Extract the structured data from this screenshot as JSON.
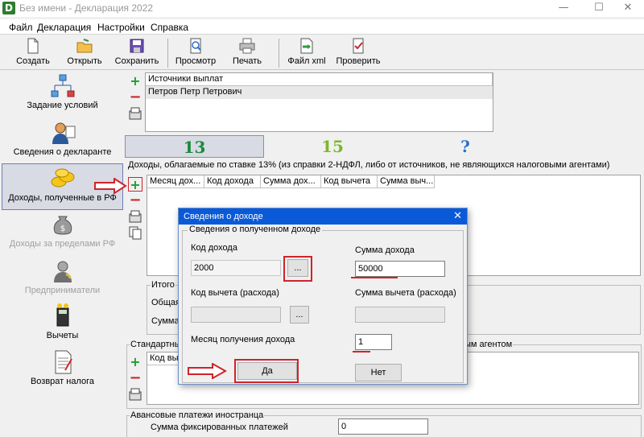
{
  "window": {
    "title": "Без имени - Декларация 2022",
    "minimize": "—",
    "maximize": "☐",
    "close": "✕"
  },
  "menu": [
    "Файл",
    "Декларация",
    "Настройки",
    "Справка"
  ],
  "toolbar": {
    "buttons": [
      {
        "label": "Создать",
        "icon": "new-file-icon"
      },
      {
        "label": "Открыть",
        "icon": "open-folder-icon"
      },
      {
        "label": "Сохранить",
        "icon": "save-icon"
      },
      {
        "label": "Просмотр",
        "icon": "preview-icon"
      },
      {
        "label": "Печать",
        "icon": "print-icon"
      },
      {
        "label": "Файл xml",
        "icon": "xml-file-icon"
      },
      {
        "label": "Проверить",
        "icon": "check-icon"
      }
    ]
  },
  "nav": {
    "items": [
      {
        "label": "Задание условий",
        "icon": "hierarchy-icon",
        "state": "normal"
      },
      {
        "label": "Сведения о декларанте",
        "icon": "person-icon",
        "state": "normal"
      },
      {
        "label": "Доходы, полученные в РФ",
        "icon": "coins-icon",
        "state": "active"
      },
      {
        "label": "Доходы за пределами РФ",
        "icon": "money-bag-icon",
        "state": "disabled"
      },
      {
        "label": "Предприниматели",
        "icon": "businessman-icon",
        "state": "disabled"
      },
      {
        "label": "Вычеты",
        "icon": "calculator-icon",
        "state": "normal"
      },
      {
        "label": "Возврат налога",
        "icon": "document-icon",
        "state": "normal"
      }
    ]
  },
  "sources": {
    "header": "Источники выплат",
    "rows": [
      "Петров Петр Петрович"
    ]
  },
  "rate_tabs": [
    "13",
    "15",
    "?"
  ],
  "income": {
    "caption": "Доходы, облагаемые по ставке 13% (из справки 2-НДФЛ, либо от источников, не являющихся налоговыми агентами)",
    "columns": [
      "Месяц дох...",
      "Код дохода",
      "Сумма дох...",
      "Код вычета",
      "Сумма выч..."
    ]
  },
  "totals": {
    "caption": "Итого",
    "row1": "Общая",
    "row2": "Сумма"
  },
  "standard": {
    "caption": "Стандартны",
    "caption_tail": "ым агентом",
    "column": "Код вы"
  },
  "advance": {
    "caption": "Авансовые платежи иностранца",
    "field_label": "Сумма фиксированных платежей",
    "field_value": "0"
  },
  "dialog": {
    "title": "Сведения о доходе",
    "close": "✕",
    "group": "Сведения о полученном доходе",
    "income_code_label": "Код дохода",
    "income_code_value": "2000",
    "income_sum_label": "Сумма дохода",
    "income_sum_value": "50000",
    "deduction_code_label": "Код вычета (расхода)",
    "deduction_code_value": "",
    "deduction_sum_label": "Сумма вычета (расхода)",
    "deduction_sum_value": "",
    "month_label": "Месяц получения дохода",
    "month_value": "1",
    "browse": "...",
    "ok": "Да",
    "cancel": "Нет"
  }
}
